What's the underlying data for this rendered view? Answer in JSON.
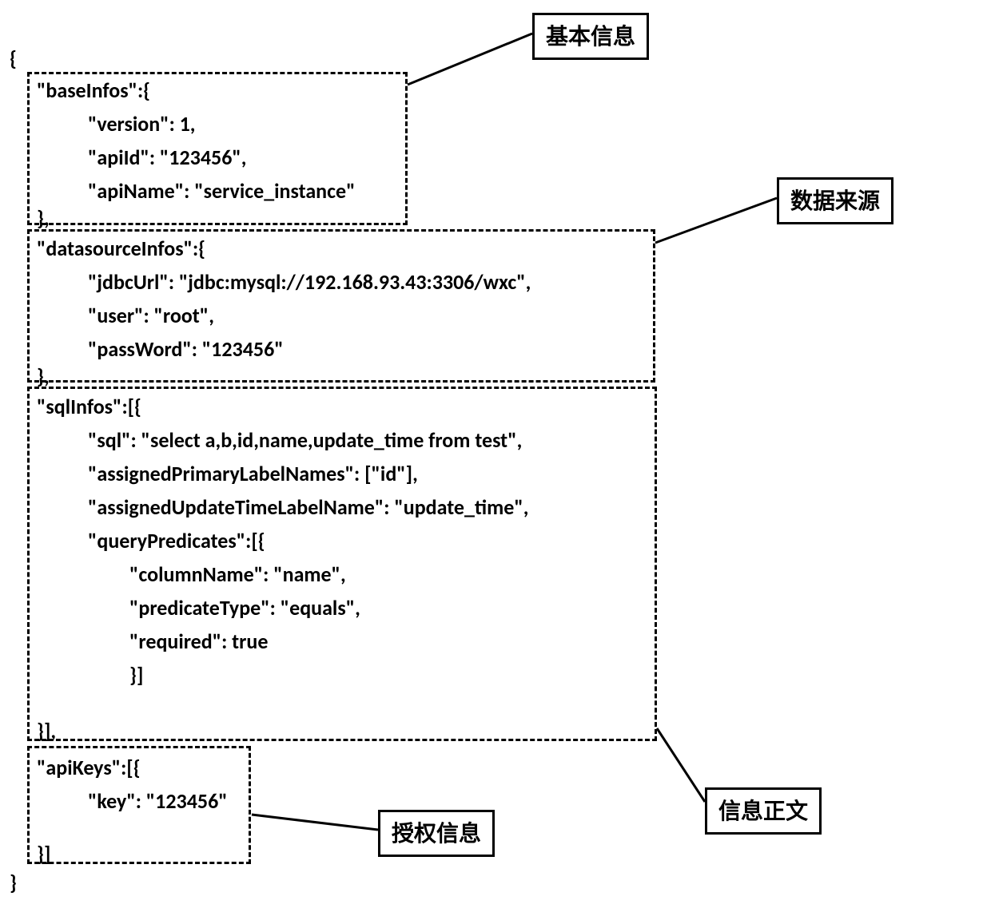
{
  "labels": {
    "basic_info": "基本信息",
    "data_source": "数据来源",
    "info_body": "信息正文",
    "auth_info": "授权信息"
  },
  "code": {
    "open_brace": "{",
    "close_brace": "}",
    "baseInfos": {
      "key": "\"baseInfos\":{",
      "version": "\"version\": 1,",
      "apiId": "\"apiId\": \"123456\",",
      "apiName": "\"apiName\": \"service_instance\"",
      "close": "},"
    },
    "datasourceInfos": {
      "key": "\"datasourceInfos\":{",
      "jdbcUrl": "\"jdbcUrl\": \"jdbc:mysql://192.168.93.43:3306/wxc\",",
      "user": "\"user\": \"root\",",
      "passWord": "\"passWord\": \"123456\"",
      "close": "},"
    },
    "sqlInfos": {
      "key": "\"sqlInfos\":[{",
      "sql": "\"sql\": \"select a,b,id,name,update_time from test\",",
      "assignedPrimary": "\"assignedPrimaryLabelNames\": [\"id\"],",
      "assignedUpdate": "\"assignedUpdateTimeLabelName\": \"update_time\",",
      "queryPredicates": "\"queryPredicates\":[{",
      "columnName": "\"columnName\": \"name\",",
      "predicateType": "\"predicateType\": \"equals\",",
      "required": "\"required\": true",
      "innerClose": "}]",
      "outerClose": "}],"
    },
    "apiKeys": {
      "key": "\"apiKeys\":[{",
      "keyVal": "\"key\": \"123456\"",
      "close": "}]"
    }
  }
}
